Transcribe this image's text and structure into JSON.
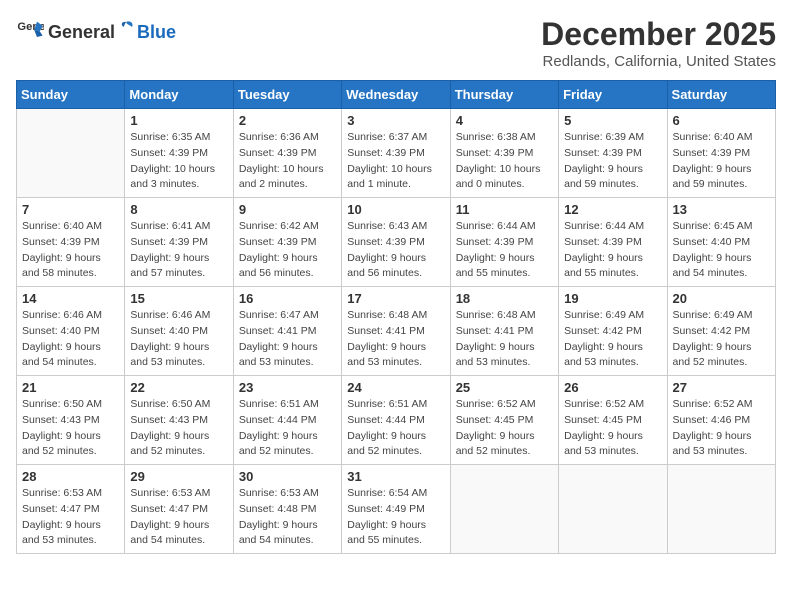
{
  "logo": {
    "general": "General",
    "blue": "Blue"
  },
  "title": "December 2025",
  "subtitle": "Redlands, California, United States",
  "days_of_week": [
    "Sunday",
    "Monday",
    "Tuesday",
    "Wednesday",
    "Thursday",
    "Friday",
    "Saturday"
  ],
  "weeks": [
    [
      {
        "day": "",
        "info": ""
      },
      {
        "day": "1",
        "info": "Sunrise: 6:35 AM\nSunset: 4:39 PM\nDaylight: 10 hours\nand 3 minutes."
      },
      {
        "day": "2",
        "info": "Sunrise: 6:36 AM\nSunset: 4:39 PM\nDaylight: 10 hours\nand 2 minutes."
      },
      {
        "day": "3",
        "info": "Sunrise: 6:37 AM\nSunset: 4:39 PM\nDaylight: 10 hours\nand 1 minute."
      },
      {
        "day": "4",
        "info": "Sunrise: 6:38 AM\nSunset: 4:39 PM\nDaylight: 10 hours\nand 0 minutes."
      },
      {
        "day": "5",
        "info": "Sunrise: 6:39 AM\nSunset: 4:39 PM\nDaylight: 9 hours\nand 59 minutes."
      },
      {
        "day": "6",
        "info": "Sunrise: 6:40 AM\nSunset: 4:39 PM\nDaylight: 9 hours\nand 59 minutes."
      }
    ],
    [
      {
        "day": "7",
        "info": "Sunrise: 6:40 AM\nSunset: 4:39 PM\nDaylight: 9 hours\nand 58 minutes."
      },
      {
        "day": "8",
        "info": "Sunrise: 6:41 AM\nSunset: 4:39 PM\nDaylight: 9 hours\nand 57 minutes."
      },
      {
        "day": "9",
        "info": "Sunrise: 6:42 AM\nSunset: 4:39 PM\nDaylight: 9 hours\nand 56 minutes."
      },
      {
        "day": "10",
        "info": "Sunrise: 6:43 AM\nSunset: 4:39 PM\nDaylight: 9 hours\nand 56 minutes."
      },
      {
        "day": "11",
        "info": "Sunrise: 6:44 AM\nSunset: 4:39 PM\nDaylight: 9 hours\nand 55 minutes."
      },
      {
        "day": "12",
        "info": "Sunrise: 6:44 AM\nSunset: 4:39 PM\nDaylight: 9 hours\nand 55 minutes."
      },
      {
        "day": "13",
        "info": "Sunrise: 6:45 AM\nSunset: 4:40 PM\nDaylight: 9 hours\nand 54 minutes."
      }
    ],
    [
      {
        "day": "14",
        "info": "Sunrise: 6:46 AM\nSunset: 4:40 PM\nDaylight: 9 hours\nand 54 minutes."
      },
      {
        "day": "15",
        "info": "Sunrise: 6:46 AM\nSunset: 4:40 PM\nDaylight: 9 hours\nand 53 minutes."
      },
      {
        "day": "16",
        "info": "Sunrise: 6:47 AM\nSunset: 4:41 PM\nDaylight: 9 hours\nand 53 minutes."
      },
      {
        "day": "17",
        "info": "Sunrise: 6:48 AM\nSunset: 4:41 PM\nDaylight: 9 hours\nand 53 minutes."
      },
      {
        "day": "18",
        "info": "Sunrise: 6:48 AM\nSunset: 4:41 PM\nDaylight: 9 hours\nand 53 minutes."
      },
      {
        "day": "19",
        "info": "Sunrise: 6:49 AM\nSunset: 4:42 PM\nDaylight: 9 hours\nand 53 minutes."
      },
      {
        "day": "20",
        "info": "Sunrise: 6:49 AM\nSunset: 4:42 PM\nDaylight: 9 hours\nand 52 minutes."
      }
    ],
    [
      {
        "day": "21",
        "info": "Sunrise: 6:50 AM\nSunset: 4:43 PM\nDaylight: 9 hours\nand 52 minutes."
      },
      {
        "day": "22",
        "info": "Sunrise: 6:50 AM\nSunset: 4:43 PM\nDaylight: 9 hours\nand 52 minutes."
      },
      {
        "day": "23",
        "info": "Sunrise: 6:51 AM\nSunset: 4:44 PM\nDaylight: 9 hours\nand 52 minutes."
      },
      {
        "day": "24",
        "info": "Sunrise: 6:51 AM\nSunset: 4:44 PM\nDaylight: 9 hours\nand 52 minutes."
      },
      {
        "day": "25",
        "info": "Sunrise: 6:52 AM\nSunset: 4:45 PM\nDaylight: 9 hours\nand 52 minutes."
      },
      {
        "day": "26",
        "info": "Sunrise: 6:52 AM\nSunset: 4:45 PM\nDaylight: 9 hours\nand 53 minutes."
      },
      {
        "day": "27",
        "info": "Sunrise: 6:52 AM\nSunset: 4:46 PM\nDaylight: 9 hours\nand 53 minutes."
      }
    ],
    [
      {
        "day": "28",
        "info": "Sunrise: 6:53 AM\nSunset: 4:47 PM\nDaylight: 9 hours\nand 53 minutes."
      },
      {
        "day": "29",
        "info": "Sunrise: 6:53 AM\nSunset: 4:47 PM\nDaylight: 9 hours\nand 54 minutes."
      },
      {
        "day": "30",
        "info": "Sunrise: 6:53 AM\nSunset: 4:48 PM\nDaylight: 9 hours\nand 54 minutes."
      },
      {
        "day": "31",
        "info": "Sunrise: 6:54 AM\nSunset: 4:49 PM\nDaylight: 9 hours\nand 55 minutes."
      },
      {
        "day": "",
        "info": ""
      },
      {
        "day": "",
        "info": ""
      },
      {
        "day": "",
        "info": ""
      }
    ]
  ]
}
